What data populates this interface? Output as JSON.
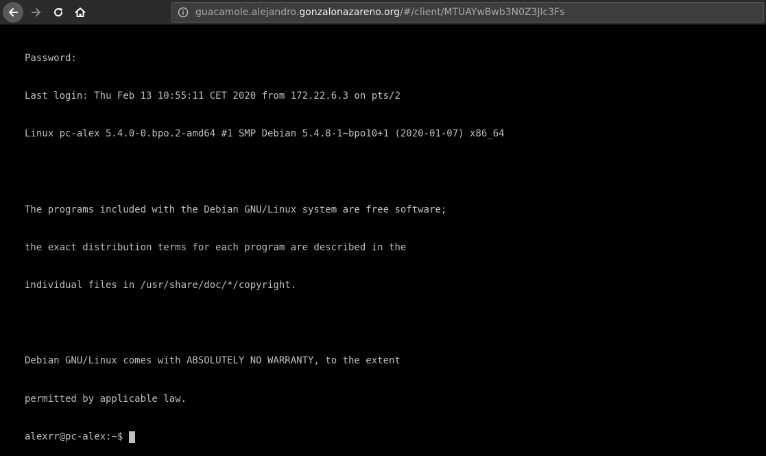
{
  "browser": {
    "url_prefix": "guacamole.alejandro.",
    "url_domain": "gonzalonazareno.org",
    "url_path": "/#/client/MTUAYwBwb3N0Z3Jlc3Fs",
    "icons": {
      "back": "arrow-left-icon",
      "forward": "arrow-right-icon",
      "reload": "reload-icon",
      "home": "home-icon",
      "info": "info-icon"
    }
  },
  "terminal": {
    "lines": [
      "Password:",
      "Last login: Thu Feb 13 10:55:11 CET 2020 from 172.22.6.3 on pts/2",
      "Linux pc-alex 5.4.0-0.bpo.2-amd64 #1 SMP Debian 5.4.8-1~bpo10+1 (2020-01-07) x86_64",
      "",
      "The programs included with the Debian GNU/Linux system are free software;",
      "the exact distribution terms for each program are described in the",
      "individual files in /usr/share/doc/*/copyright.",
      "",
      "Debian GNU/Linux comes with ABSOLUTELY NO WARRANTY, to the extent",
      "permitted by applicable law."
    ],
    "prompt": "alexrr@pc-alex:~$"
  },
  "colors": {
    "terminal_bg": "#000000",
    "terminal_fg": "#bfbfbf",
    "toolbar_bg": "#2b2b2b"
  }
}
